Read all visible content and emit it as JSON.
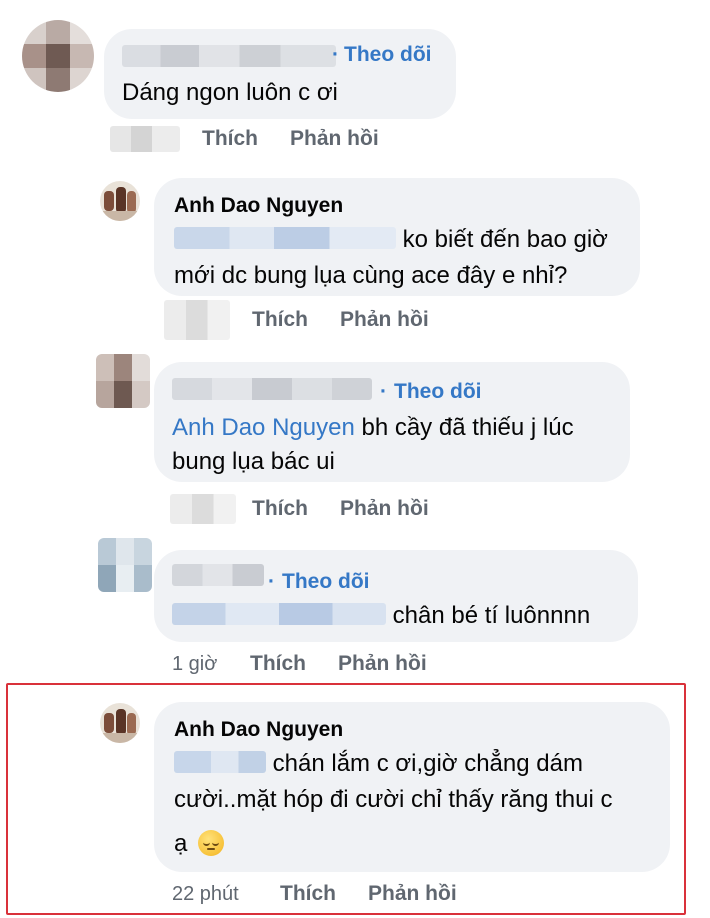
{
  "labels": {
    "like": "Thích",
    "reply": "Phản hồi",
    "follow": "Theo dõi",
    "dot": "·"
  },
  "comments": [
    {
      "author": "",
      "text_line1": "Dáng ngon luôn c ơi",
      "time": ""
    },
    {
      "author": "Anh Dao Nguyen",
      "mention": "",
      "text_line1": " ko biết đến bao giờ",
      "text_line2": "mới dc bung lụa cùng ace đây e nhỉ?",
      "time": ""
    },
    {
      "author": "",
      "mention": "Anh Dao Nguyen",
      "text_line1": " bh cầy đã thiếu j lúc",
      "text_line2": "bung lụa bác ui",
      "time": ""
    },
    {
      "author": "",
      "mention": "",
      "text_line1": " chân bé tí luônnnn",
      "time": "1 giờ"
    },
    {
      "author": "Anh Dao Nguyen",
      "mention": "",
      "text_line1": " chán lắm c ơi,giờ chẳng dám",
      "text_line2": "cười..mặt hóp đi cười chỉ thấy răng thui c",
      "text_line3": "ạ",
      "emoji": "pensive-face",
      "time": "22 phút"
    }
  ],
  "colors": {
    "bubble": "#f0f2f5",
    "link": "#3578c6",
    "muted": "#606770",
    "highlight_border": "#d9313a"
  }
}
